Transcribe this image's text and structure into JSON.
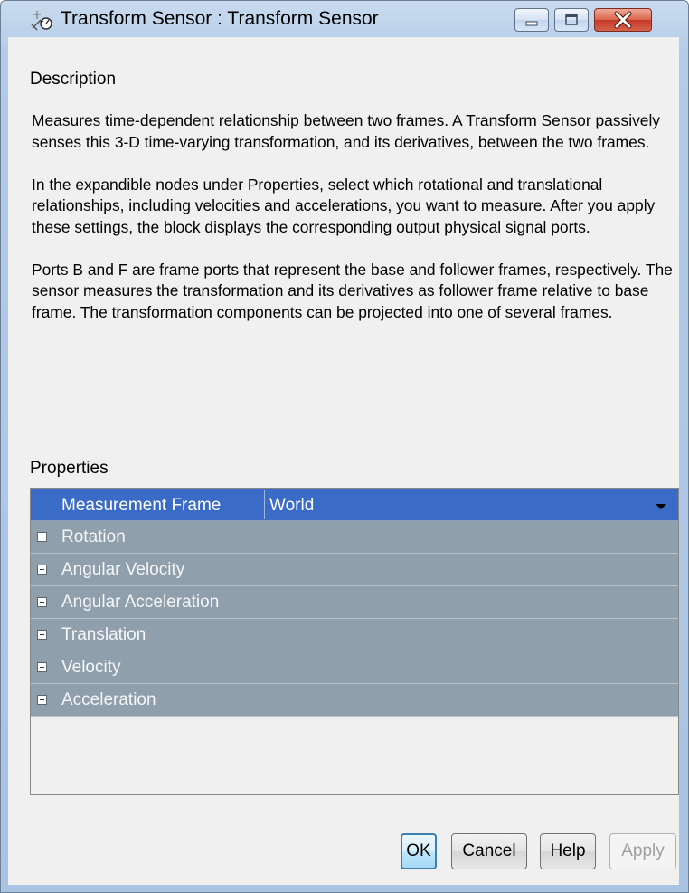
{
  "window": {
    "title": "Transform Sensor : Transform  Sensor"
  },
  "description": {
    "label": "Description",
    "paragraphs": [
      "Measures time-dependent relationship between two frames. A Transform Sensor passively senses this 3-D time-varying transformation, and its derivatives, between the two frames.",
      "In the expandible nodes under Properties, select which rotational and translational relationships, including velocities and accelerations, you want to measure. After you apply these settings, the block displays the corresponding output physical signal ports.",
      "Ports B and F are frame ports that represent the base and follower frames, respectively. The sensor measures the transformation and its derivatives as follower frame relative to base frame. The transformation components can be projected into one of several frames."
    ]
  },
  "properties": {
    "label": "Properties",
    "measurement_frame": {
      "name": "Measurement Frame",
      "value": "World"
    },
    "nodes": [
      "Rotation",
      "Angular Velocity",
      "Angular Acceleration",
      "Translation",
      "Velocity",
      "Acceleration"
    ]
  },
  "buttons": {
    "ok": "OK",
    "cancel": "Cancel",
    "help": "Help",
    "apply": "Apply"
  },
  "icons": {
    "app": "transform-sensor-icon",
    "minimize": "minimize-icon",
    "maximize": "maximize-icon",
    "close": "close-icon",
    "expand": "plus-expand-icon",
    "dropdown": "dropdown-arrow-icon"
  },
  "colors": {
    "selection": "#3a6bc7",
    "node_row": "#8f9fac",
    "close_button": "#c6392a",
    "ok_border": "#3c7fb1"
  }
}
